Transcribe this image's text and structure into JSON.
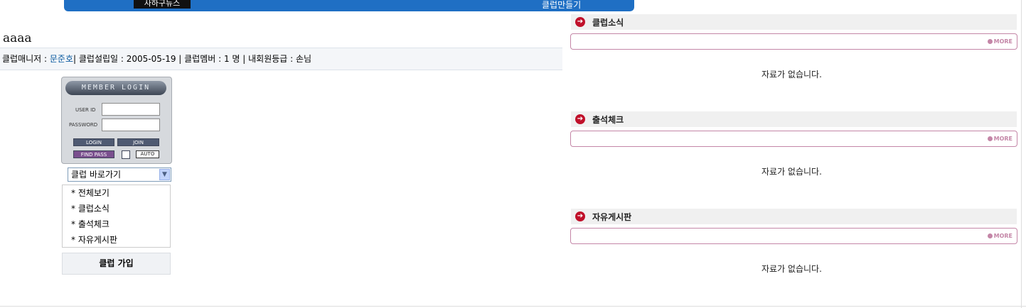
{
  "top_bar": {
    "news": "사하구뉴스",
    "make_club": "클럽만들기"
  },
  "club": {
    "title": "aaaa"
  },
  "info": {
    "manager_label": "클럽매니저 : ",
    "manager_name": "문준호",
    "est_text": "| 클럽설립일 : 2005-05-19 | 클럽멤버 : 1 명 | 내회원등급 : 손님"
  },
  "login": {
    "header": "MEMBER LOGIN",
    "user_id_label": "USER ID",
    "password_label": "PASSWORD",
    "login_btn": "LOGIN",
    "join_btn": "JOIN",
    "find_pass_btn": "FIND PASS",
    "auto_label": "AUTO"
  },
  "club_select": {
    "value": "클럽 바로가기"
  },
  "menu": {
    "items": [
      "* 전체보기",
      "* 클럽소식",
      "* 출석체크",
      "* 자유게시판"
    ]
  },
  "join_button": "클럽 가입",
  "sections": [
    {
      "title": "클럽소식",
      "more": "MORE",
      "empty": "자료가 없습니다."
    },
    {
      "title": "출석체크",
      "more": "MORE",
      "empty": "자료가 없습니다."
    },
    {
      "title": "자유게시판",
      "more": "MORE",
      "empty": "자료가 없습니다."
    }
  ]
}
